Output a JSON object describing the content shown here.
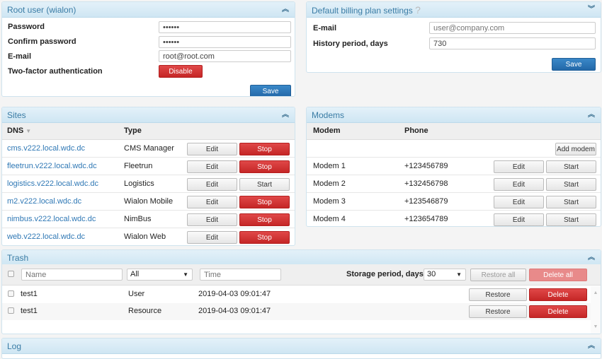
{
  "root_user": {
    "title": "Root user (wialon)",
    "password_label": "Password",
    "password_value": "••••••",
    "confirm_label": "Confirm password",
    "confirm_value": "••••••",
    "email_label": "E-mail",
    "email_value": "root@root.com",
    "twofa_label": "Two-factor authentication",
    "disable_label": "Disable",
    "save_label": "Save"
  },
  "billing": {
    "title": "Default billing plan settings",
    "help": "?",
    "email_label": "E-mail",
    "email_placeholder": "user@company.com",
    "history_label": "History period, days",
    "history_value": "730",
    "save_label": "Save"
  },
  "sites": {
    "title": "Sites",
    "col_dns": "DNS",
    "col_type": "Type",
    "edit_label": "Edit",
    "rows": [
      {
        "dns": "cms.v222.local.wdc.dc",
        "type": "CMS Manager",
        "action": "Stop"
      },
      {
        "dns": "fleetrun.v222.local.wdc.dc",
        "type": "Fleetrun",
        "action": "Stop"
      },
      {
        "dns": "logistics.v222.local.wdc.dc",
        "type": "Logistics",
        "action": "Start"
      },
      {
        "dns": "m2.v222.local.wdc.dc",
        "type": "Wialon Mobile",
        "action": "Stop"
      },
      {
        "dns": "nimbus.v222.local.wdc.dc",
        "type": "NimBus",
        "action": "Stop"
      },
      {
        "dns": "web.v222.local.wdc.dc",
        "type": "Wialon Web",
        "action": "Stop"
      }
    ]
  },
  "modems": {
    "title": "Modems",
    "col_modem": "Modem",
    "col_phone": "Phone",
    "add_label": "Add modem",
    "edit_label": "Edit",
    "start_label": "Start",
    "rows": [
      {
        "name": "Modem 1",
        "phone": "+123456789"
      },
      {
        "name": "Modem 2",
        "phone": "+132456798"
      },
      {
        "name": "Modem 3",
        "phone": "+123546879"
      },
      {
        "name": "Modem 4",
        "phone": "+123654789"
      }
    ]
  },
  "trash": {
    "title": "Trash",
    "name_placeholder": "Name",
    "type_filter": "All",
    "time_placeholder": "Time",
    "storage_label": "Storage period, days:",
    "storage_value": "30",
    "restore_all": "Restore all",
    "delete_all": "Delete all",
    "restore_label": "Restore",
    "delete_label": "Delete",
    "rows": [
      {
        "name": "test1",
        "type": "User",
        "time": "2019-04-03 09:01:47"
      },
      {
        "name": "test1",
        "type": "Resource",
        "time": "2019-04-03 09:01:47"
      }
    ]
  },
  "log": {
    "title": "Log"
  }
}
